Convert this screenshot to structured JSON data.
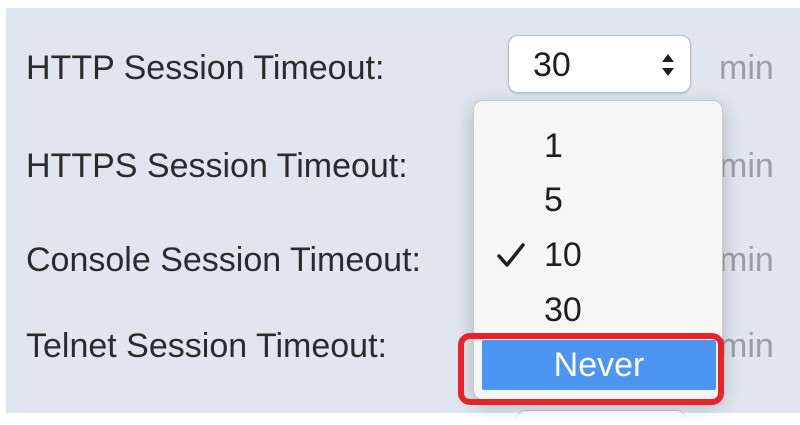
{
  "rows": [
    {
      "label": "HTTP Session Timeout:",
      "unit": "min"
    },
    {
      "label": "HTTPS Session Timeout:",
      "unit": "min"
    },
    {
      "label": "Console Session Timeout:",
      "unit": "min"
    },
    {
      "label": "Telnet Session Timeout:",
      "unit": "min"
    }
  ],
  "http_select": {
    "value": "30",
    "icon": "stepper-arrows-icon"
  },
  "dropdown": {
    "options": [
      "1",
      "5",
      "10",
      "30",
      "Never"
    ],
    "checked_option": "10",
    "highlighted_option": "Never",
    "check_icon": "checkmark-icon"
  },
  "colors": {
    "panel_bg": "#dfe6ef",
    "highlight_blue": "#4d95f2",
    "annotation_red": "#e8222b",
    "unit_gray": "#9a9ea4"
  }
}
